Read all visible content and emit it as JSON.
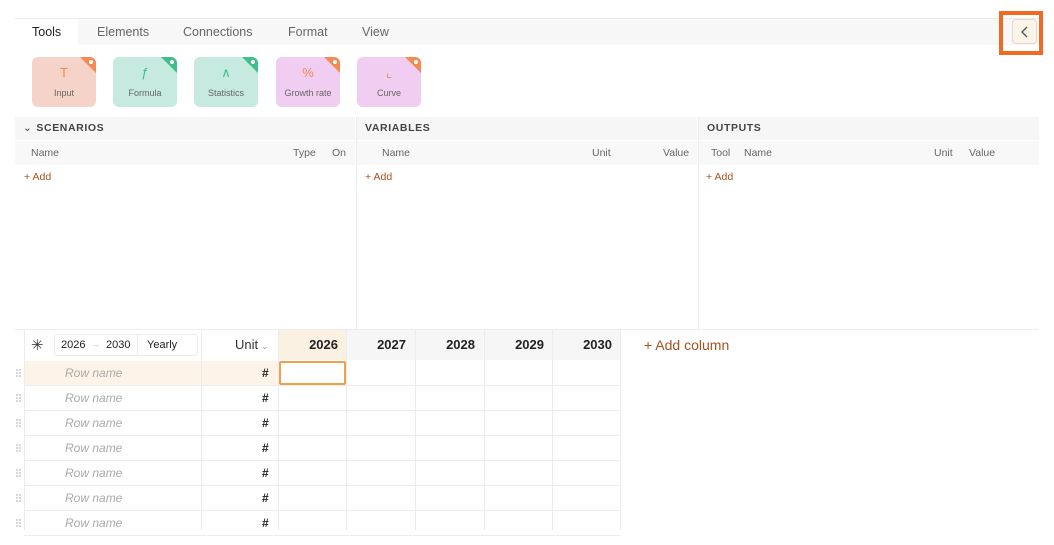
{
  "tabs": [
    {
      "label": "Tools",
      "active": true
    },
    {
      "label": "Elements"
    },
    {
      "label": "Connections"
    },
    {
      "label": "Format"
    },
    {
      "label": "View"
    }
  ],
  "collapse_button": {
    "icon": "chevron-left-icon"
  },
  "tools": [
    {
      "label": "Input",
      "glyph": "T",
      "bg": "#f6d3c9",
      "accent": "#f28a52",
      "icon": "text-icon"
    },
    {
      "label": "Formula",
      "glyph": "ƒ",
      "bg": "#c6eadf",
      "accent": "#3fbf8a",
      "icon": "function-icon"
    },
    {
      "label": "Statistics",
      "glyph": "∧",
      "bg": "#c6eadf",
      "accent": "#3fbf8a",
      "icon": "bell-curve-icon"
    },
    {
      "label": "Growth rate",
      "glyph": "%",
      "bg": "#f2cdf2",
      "accent": "#f28a52",
      "icon": "percent-icon"
    },
    {
      "label": "Curve",
      "glyph": "⌞",
      "bg": "#f2cdf2",
      "accent": "#f28a52",
      "icon": "chart-line-icon"
    }
  ],
  "scenarios": {
    "title": "SCENARIOS",
    "columns": [
      "Name",
      "Type",
      "On"
    ],
    "add_label": "+ Add"
  },
  "variables": {
    "title": "VARIABLES",
    "columns": [
      "Name",
      "Unit",
      "Value"
    ],
    "add_label": "+ Add"
  },
  "outputs": {
    "title": "OUTPUTS",
    "columns": [
      "Tool",
      "Name",
      "Unit",
      "Value"
    ],
    "add_label": "+ Add"
  },
  "grid": {
    "start_year": "2026",
    "end_year": "2030",
    "period": "Yearly",
    "unit_header": "Unit",
    "years": [
      "2026",
      "2027",
      "2028",
      "2029",
      "2030"
    ],
    "add_column_label": "+ Add column",
    "row_placeholder": "Row name",
    "unit_symbol": "#",
    "row_count": 7
  },
  "colors": {
    "accent_orange": "#f06a24",
    "link": "#a5521d"
  }
}
